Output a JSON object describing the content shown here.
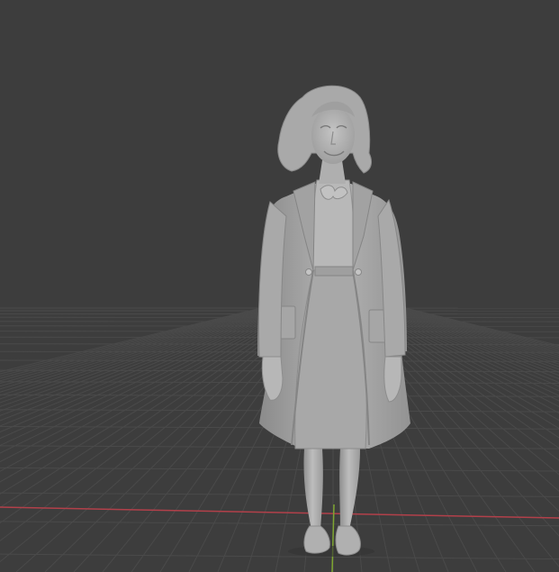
{
  "viewport": {
    "background_color": "#3d3d3d",
    "grid_color": "#4a4a4a",
    "x_axis_color": "#b2404a",
    "y_axis_color": "#7ea531",
    "model_color": "#b5b5b5",
    "model_subject": "standing-woman-sculpt",
    "show_floor_grid": true
  }
}
